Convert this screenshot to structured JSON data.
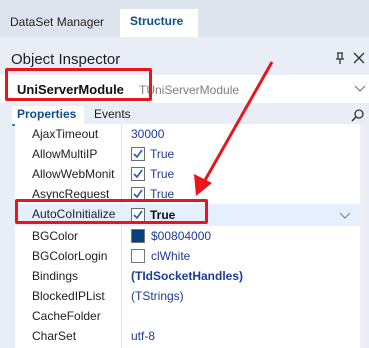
{
  "doc_tabs": [
    "DataSet Manager",
    "Structure"
  ],
  "panel": {
    "title": "Object Inspector",
    "object_name": "UniServerModule",
    "object_class": "TUniServerModule",
    "tabs": [
      "Properties",
      "Events"
    ]
  },
  "properties": [
    {
      "name": "AjaxTimeout",
      "value": "30000",
      "kind": "text"
    },
    {
      "name": "AllowMultiIP",
      "value": "True",
      "kind": "check"
    },
    {
      "name": "AllowWebMonit",
      "value": "True",
      "kind": "check"
    },
    {
      "name": "AsyncRequest",
      "value": "True",
      "kind": "check"
    },
    {
      "name": "AutoCoInitialize",
      "value": "True",
      "kind": "check",
      "selected": true
    },
    {
      "name": "BGColor",
      "value": "$00804000",
      "kind": "color",
      "color": "#004080"
    },
    {
      "name": "BGColorLogin",
      "value": "clWhite",
      "kind": "color",
      "color": "#ffffff"
    },
    {
      "name": "Bindings",
      "value": "(TIdSocketHandles)",
      "kind": "bold"
    },
    {
      "name": "BlockedIPList",
      "value": "(TStrings)",
      "kind": "text"
    },
    {
      "name": "CacheFolder",
      "value": "",
      "kind": "text"
    },
    {
      "name": "CharSet",
      "value": "utf-8",
      "kind": "text"
    }
  ],
  "colors": {
    "annotation": "#e8141e",
    "accent": "#0e4f8c",
    "check": "#1f5fb8"
  },
  "icons": [
    "pin-icon",
    "close-icon",
    "chevron-down-icon",
    "search-icon",
    "checkmark-icon",
    "arrow-annotation"
  ]
}
